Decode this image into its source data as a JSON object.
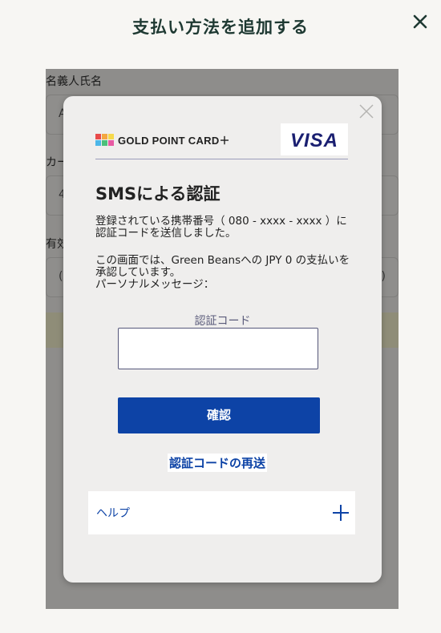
{
  "header": {
    "title": "支払い方法を追加する",
    "close_icon": "close-icon"
  },
  "form": {
    "cardholder_label": "名義人氏名",
    "cardholder_hint": "A",
    "card_number_label": "カード",
    "card_number_hint": "4",
    "expiry_label": "有効",
    "expiry_hint": "(",
    "expiry_suffix": ")"
  },
  "modal": {
    "brand": {
      "card_logo_text": "GOLD POINT CARD＋",
      "network_logo_text": "VISA",
      "logo_block_colors": [
        "#e84a4a",
        "#f4a640",
        "#f6d94b",
        "#4cb6e8",
        "#4cc07a",
        "#e85aa3"
      ]
    },
    "title": "SMSによる認証",
    "message_line1": "登録されている携帯番号（ 080 - xxxx - xxxx ）に認証コードを送信しました。",
    "message_line2": "この画面では、Green Beansへの JPY 0 の支払いを承認しています。",
    "message_line3": "パーソナルメッセージ：",
    "code_label": "認証コード",
    "code_value": "",
    "confirm_label": "確認",
    "resend_label": "認証コードの再送",
    "help_label": "ヘルプ"
  },
  "colors": {
    "title_green": "#1e3932",
    "primary_blue": "#0d43a6",
    "visa_blue": "#1a1f71"
  }
}
